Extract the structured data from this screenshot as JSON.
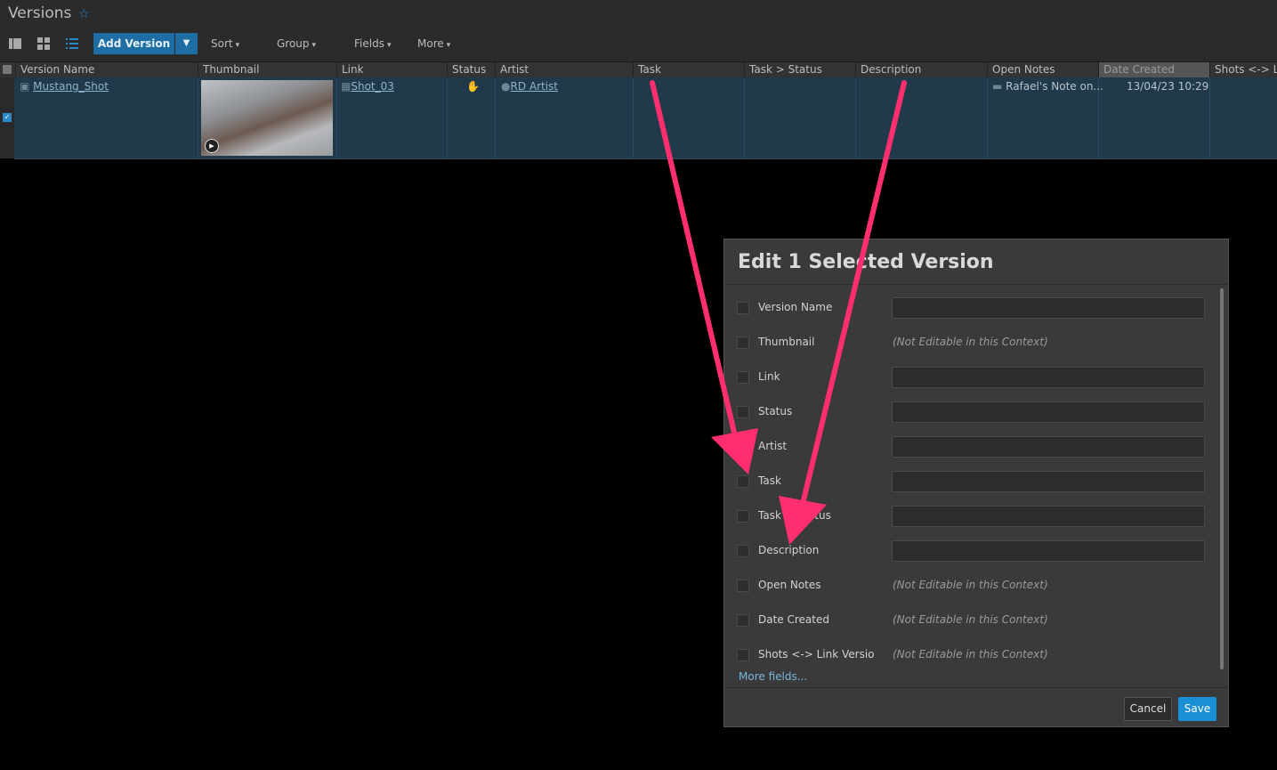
{
  "header": {
    "page_title": "Versions",
    "add_version_label": "Add Version",
    "sort_label": "Sort",
    "group_label": "Group",
    "fields_label": "Fields",
    "more_label": "More"
  },
  "table": {
    "columns": [
      "Version Name",
      "Thumbnail",
      "Link",
      "Status",
      "Artist",
      "Task",
      "Task > Status",
      "Description",
      "Open Notes",
      "Date Created",
      "Shots <-> Lin"
    ],
    "row": {
      "version_name": "Mustang_Shot",
      "link": "Shot_03",
      "artist": "RD Artist",
      "open_notes": "Rafael's Note on...",
      "date_created": "13/04/23 10:29"
    }
  },
  "dialog": {
    "title": "Edit 1 Selected Version",
    "fields": [
      {
        "label": "Version Name",
        "note": ""
      },
      {
        "label": "Thumbnail",
        "note": "(Not Editable in this Context)"
      },
      {
        "label": "Link",
        "note": ""
      },
      {
        "label": "Status",
        "note": ""
      },
      {
        "label": "Artist",
        "note": ""
      },
      {
        "label": "Task",
        "note": ""
      },
      {
        "label": "Task > Status",
        "note": ""
      },
      {
        "label": "Description",
        "note": ""
      },
      {
        "label": "Open Notes",
        "note": "(Not Editable in this Context)"
      },
      {
        "label": "Date Created",
        "note": "(Not Editable in this Context)"
      },
      {
        "label": "Shots <-> Link Version",
        "note": "(Not Editable in this Context)"
      }
    ],
    "more_fields": "More fields...",
    "cancel_label": "Cancel",
    "save_label": "Save"
  },
  "colors": {
    "accent": "#1a8fd6",
    "selected_row": "#213a4b",
    "annotation_arrow": "#ff2e6e"
  }
}
